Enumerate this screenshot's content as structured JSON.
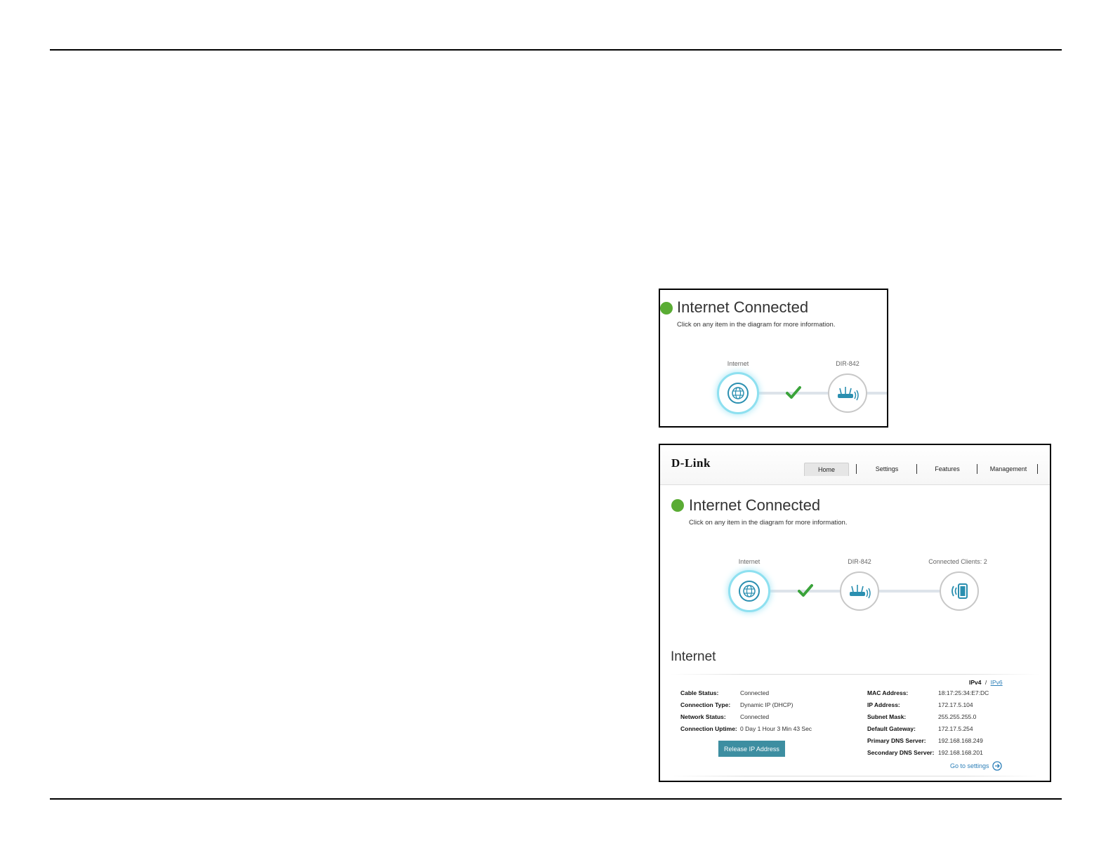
{
  "small_shot": {
    "status_title": "Internet Connected",
    "hint": "Click on any item in the diagram for more information.",
    "nodes": [
      {
        "label": "Internet",
        "icon": "globe-icon"
      },
      {
        "label": "DIR-842",
        "icon": "router-icon"
      }
    ]
  },
  "large_shot": {
    "brand": "D-Link",
    "tabs": [
      {
        "label": "Home",
        "selected": true
      },
      {
        "label": "Settings",
        "selected": false
      },
      {
        "label": "Features",
        "selected": false
      },
      {
        "label": "Management",
        "selected": false
      }
    ],
    "status_title": "Internet Connected",
    "hint": "Click on any item in the diagram for more information.",
    "nodes": [
      {
        "label": "Internet",
        "icon": "globe-icon"
      },
      {
        "label": "DIR-842",
        "icon": "router-icon"
      },
      {
        "label": "Connected Clients: 2",
        "icon": "tablet-icon"
      }
    ],
    "section_title": "Internet",
    "ip_toggle": {
      "ipv4": "IPv4",
      "separator": "/",
      "ipv6": "IPv6"
    },
    "left_info": [
      {
        "key": "Cable Status:",
        "value": "Connected"
      },
      {
        "key": "Connection Type:",
        "value": "Dynamic IP (DHCP)"
      },
      {
        "key": "Network Status:",
        "value": "Connected"
      },
      {
        "key": "Connection Uptime:",
        "value": "0 Day 1 Hour 3 Min 43 Sec"
      }
    ],
    "right_info": [
      {
        "key": "MAC Address:",
        "value": "18:17:25:34:E7:DC"
      },
      {
        "key": "IP Address:",
        "value": "172.17.5.104"
      },
      {
        "key": "Subnet Mask:",
        "value": "255.255.255.0"
      },
      {
        "key": "Default Gateway:",
        "value": "172.17.5.254"
      },
      {
        "key": "Primary DNS Server:",
        "value": "192.168.168.249"
      },
      {
        "key": "Secondary DNS Server:",
        "value": "192.168.168.201"
      }
    ],
    "release_button": "Release IP Address",
    "goto_settings": "Go to settings"
  },
  "colors": {
    "status_green": "#5aac34",
    "accent_teal": "#3d8ea1",
    "link_blue": "#2c7fb8",
    "node_glow": "#8ee0f0"
  }
}
